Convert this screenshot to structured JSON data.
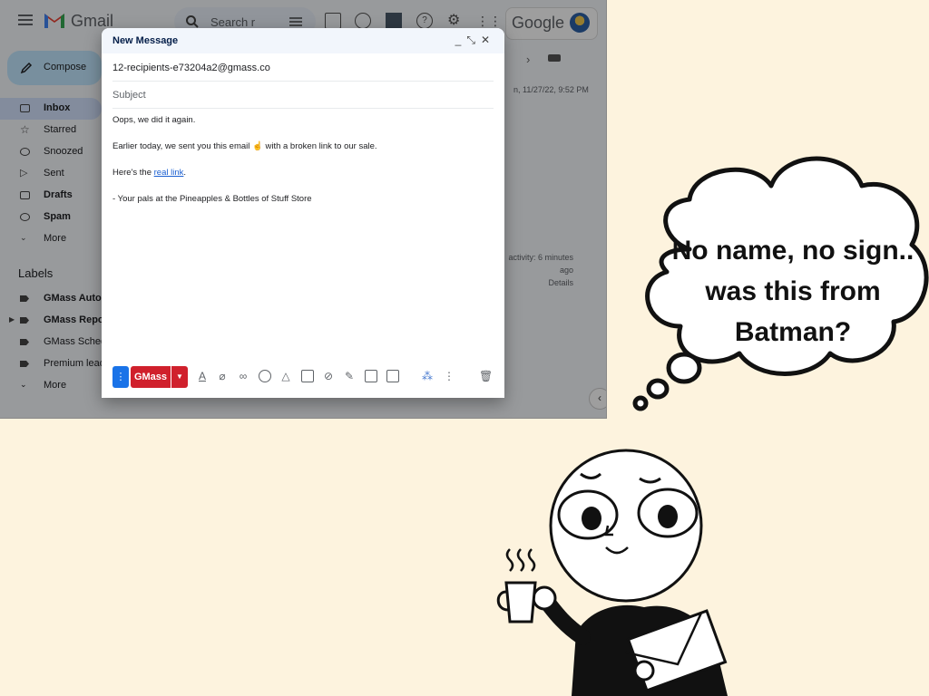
{
  "gmail": {
    "app_name": "Gmail",
    "search_placeholder": "Search r",
    "brand": "Google",
    "compose_label": "Compose",
    "nav": [
      {
        "label": "Inbox",
        "active": true
      },
      {
        "label": "Starred"
      },
      {
        "label": "Snoozed"
      },
      {
        "label": "Sent"
      },
      {
        "label": "Drafts",
        "bold": true
      },
      {
        "label": "Spam",
        "bold": true
      },
      {
        "label": "More"
      }
    ],
    "labels_heading": "Labels",
    "labels": [
      {
        "label": "GMass Auto",
        "bold": true
      },
      {
        "label": "GMass Repo",
        "bold": true
      },
      {
        "label": "GMass Sched"
      },
      {
        "label": "Premium lead"
      },
      {
        "label": "More"
      }
    ],
    "right_pane": {
      "date": "n, 11/27/22, 9:52 PM",
      "activity_line1": "activity: 6 minutes",
      "activity_line2": "ago",
      "details": "Details"
    }
  },
  "compose": {
    "title": "New Message",
    "to": "12-recipients-e73204a2@gmass.co",
    "subject_placeholder": "Subject",
    "body": {
      "line1": "Oops, we did it again.",
      "line2": "Earlier today, we sent you this email ☝️ with a broken link to our sale.",
      "line3_prefix": "Here's the ",
      "line3_link": "real link",
      "line3_suffix": ".",
      "line4": "- Your pals at the Pineapples & Bottles of Stuff Store"
    },
    "send_label": "GMass"
  },
  "bubble": {
    "line1": "No name, no sign..",
    "line2": "was this from",
    "line3": "Batman?"
  },
  "colors": {
    "background": "#fdf3de",
    "gmass_red": "#d0202c",
    "link_blue": "#1a5fd1"
  }
}
